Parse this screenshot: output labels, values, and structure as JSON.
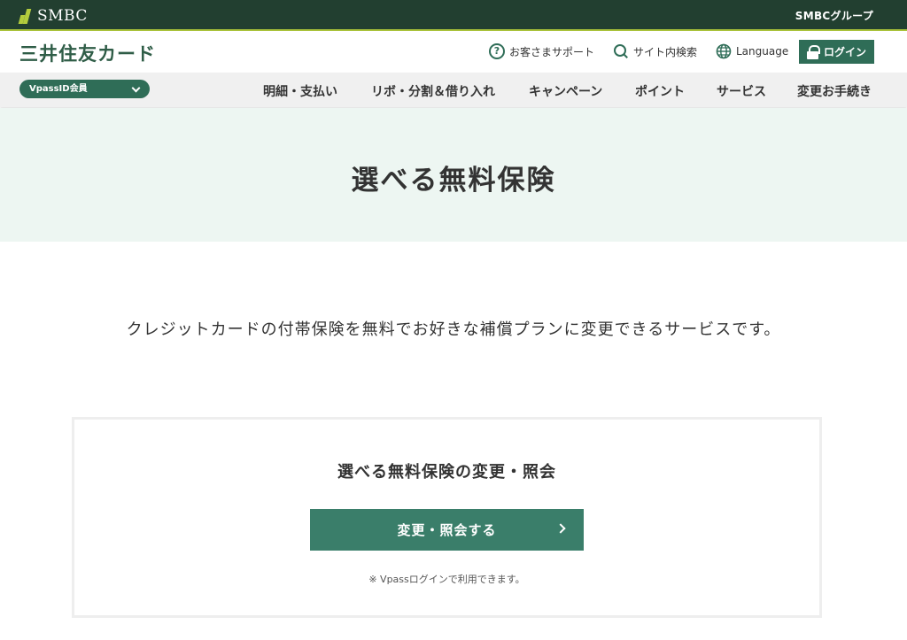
{
  "topbar": {
    "logo_text": "SMBC",
    "group_text": "SMBCグループ"
  },
  "header": {
    "brand": "三井住友カード",
    "support": "お客さまサポート",
    "site_search": "サイト内検索",
    "language": "Language",
    "login": "ログイン"
  },
  "nav": {
    "member_select": "VpassID会員",
    "items": [
      {
        "label": "明細・支払い"
      },
      {
        "label": "リボ・分割＆借り入れ"
      },
      {
        "label": "キャンペーン"
      },
      {
        "label": "ポイント"
      },
      {
        "label": "サービス"
      },
      {
        "label": "変更お手続き"
      }
    ]
  },
  "hero": {
    "title": "選べる無料保険"
  },
  "lead": "クレジットカードの付帯保険を無料でお好きな補償プランに変更できるサービスです。",
  "card": {
    "title": "選べる無料保険の変更・照会",
    "button": "変更・照会する",
    "note": "※ Vpassログインで利用できます。"
  },
  "colors": {
    "topbar": "#223f30",
    "accent_line": "#a9c23a",
    "brand_green": "#2f6d57",
    "button_green": "#3a7e6a",
    "hero_bg": "#edf6f2"
  }
}
